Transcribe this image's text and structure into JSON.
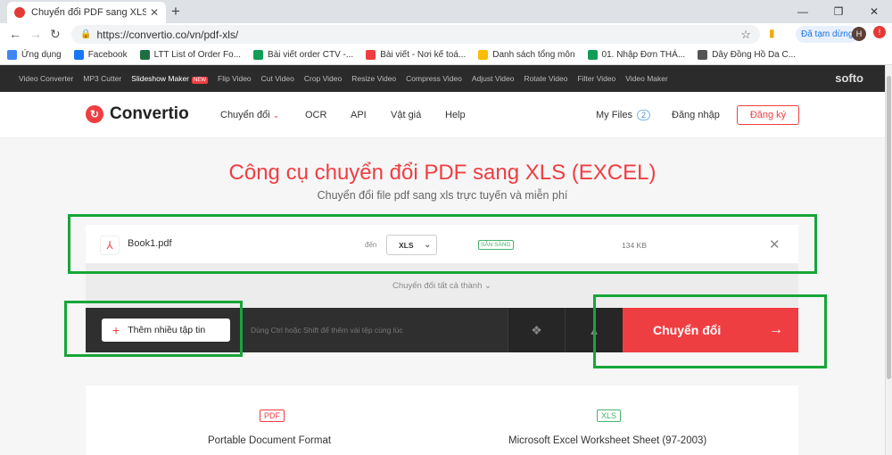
{
  "browser": {
    "tab_title": "Chuyển đổi PDF sang XLS (EXCEL",
    "url": "https://convertio.co/vn/pdf-xls/",
    "paused_label": "Đã tạm dừng",
    "avatar_letter": "H",
    "bookmarks": [
      {
        "label": "Ứng dụng",
        "icon": "apps-icon",
        "color": "#4285f4"
      },
      {
        "label": "Facebook",
        "icon": "facebook-icon",
        "color": "#1877f2"
      },
      {
        "label": "LTT List of Order Fo...",
        "icon": "excel-x-icon",
        "color": "#1d6f42"
      },
      {
        "label": "Bài viết order CTV -...",
        "icon": "sheets-icon",
        "color": "#0f9d58"
      },
      {
        "label": "Bài viết - Nơi kế toá...",
        "icon": "convertio-icon",
        "color": "#ef3e42"
      },
      {
        "label": "Danh sách tổng môn",
        "icon": "drive-icon",
        "color": "#fbbc04"
      },
      {
        "label": "01. Nhập Đơn THÁ...",
        "icon": "sheets-icon",
        "color": "#0f9d58"
      },
      {
        "label": "Dây Đồng Hồ Da C...",
        "icon": "watch-icon",
        "color": "#555555"
      }
    ]
  },
  "tools_bar": {
    "items": [
      "Video Converter",
      "MP3 Cutter",
      "Slideshow Maker",
      "Flip Video",
      "Cut Video",
      "Crop Video",
      "Resize Video",
      "Compress Video",
      "Adjust Video",
      "Rotate Video",
      "Filter Video",
      "Video Maker"
    ],
    "new_badge": "NEW",
    "brand": "softo"
  },
  "header": {
    "logo": "Convertio",
    "nav": [
      "Chuyển đổi",
      "OCR",
      "API",
      "Vật giá",
      "Help"
    ],
    "my_files": "My Files",
    "my_files_count": "2",
    "login": "Đăng nhập",
    "signup": "Đăng ký"
  },
  "hero": {
    "title": "Công cụ chuyển đổi PDF sang XLS (EXCEL)",
    "subtitle": "Chuyển đổi file pdf sang xls trực tuyến và miễn phí"
  },
  "file": {
    "name": "Book1.pdf",
    "to_label": "đến",
    "format": "XLS",
    "status": "SẴN SÀNG",
    "size": "134 KB"
  },
  "convert_all": "Chuyển đổi tất cả thành",
  "actions": {
    "add_files": "Thêm nhiều tập tin",
    "hint": "Dùng Ctrl hoặc Shift để thêm vài tệp cùng lúc",
    "convert": "Chuyển đổi"
  },
  "formats": {
    "from_badge": "PDF",
    "from_desc": "Portable Document Format",
    "to_badge": "XLS",
    "to_desc": "Microsoft Excel Worksheet Sheet (97-2003)"
  },
  "colors": {
    "accent": "#ef3e42",
    "highlight": "#17a639",
    "ready": "#48b36b"
  }
}
